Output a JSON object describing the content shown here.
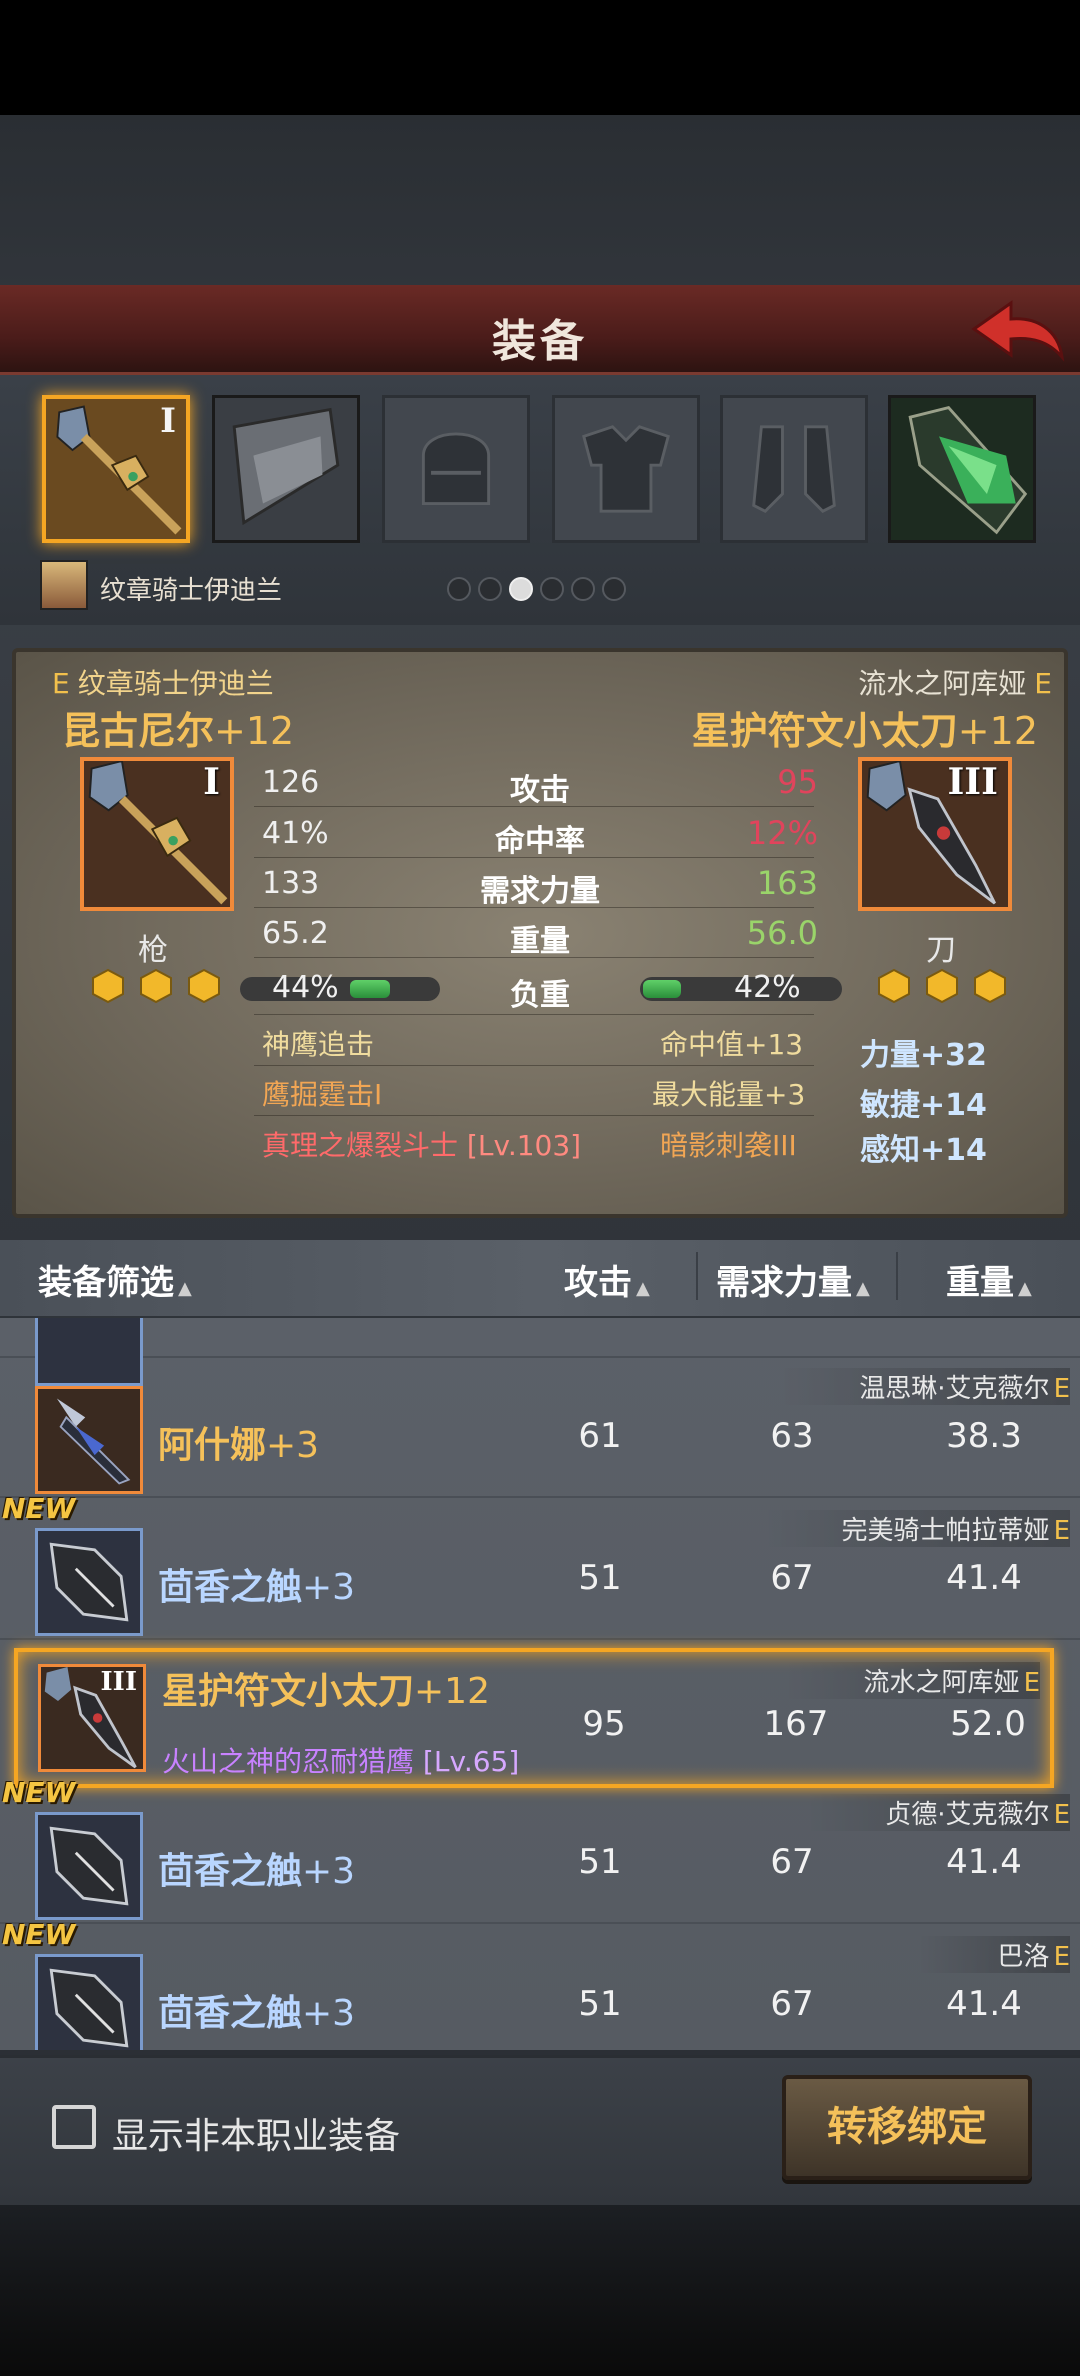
{
  "header": {
    "title": "装备"
  },
  "character": {
    "name": "纹章骑士伊迪兰"
  },
  "slots": [
    {
      "name": "spear-slot",
      "rank": "I",
      "selected": true
    },
    {
      "name": "banner-slot"
    },
    {
      "name": "helmet-slot"
    },
    {
      "name": "armor-slot"
    },
    {
      "name": "boots-slot"
    },
    {
      "name": "green-gem-slot"
    }
  ],
  "compare": {
    "left": {
      "owner": "纹章骑士伊迪兰",
      "owner_tag": "E",
      "weapon": "昆古尼尔",
      "plus": "+12",
      "rank": "I",
      "type": "枪",
      "attack": "126",
      "hit": "41%",
      "str": "133",
      "weight": "65.2",
      "load": "44%",
      "load_fraction": 0.44
    },
    "right": {
      "owner": "流水之阿库娅",
      "owner_tag": "E",
      "weapon": "星护符文小太刀",
      "plus": "+12",
      "rank": "III",
      "type": "刀",
      "attack": "95",
      "hit": "12%",
      "str": "163",
      "weight": "56.0",
      "load": "42%",
      "load_fraction": 0.42
    },
    "labels": {
      "attack": "攻击",
      "hit": "命中率",
      "str": "需求力量",
      "weight": "重量",
      "load": "负重"
    },
    "skills_left": [
      "神鹰追击",
      "鹰掘霆击I",
      "真理之爆裂斗士",
      "[Lv.103]"
    ],
    "skills_right": [
      "命中值+13",
      "最大能量+3",
      "暗影刺袭III"
    ],
    "bonuses": [
      "力量+32",
      "敏捷+14",
      "感知+14"
    ]
  },
  "list_header": {
    "filter": "装备筛选",
    "attack": "攻击",
    "str": "需求力量",
    "weight": "重量"
  },
  "list": [
    {
      "owner": "温思琳·艾克薇尔",
      "owner_tag": "E",
      "name": "阿什娜",
      "plus": "+3",
      "attack": "61",
      "str": "63",
      "weight": "38.3",
      "new": false,
      "icon_border": "orange"
    },
    {
      "owner": "完美骑士帕拉蒂娅",
      "owner_tag": "E",
      "name": "茴香之触",
      "plus": "+3",
      "attack": "51",
      "str": "67",
      "weight": "41.4",
      "new": true,
      "new_label": "NEW",
      "icon_border": "blue"
    },
    {
      "owner": "流水之阿库娅",
      "owner_tag": "E",
      "name": "星护符文小太刀",
      "plus": "+12",
      "rank": "III",
      "sub": "火山之神的忍耐猎鹰",
      "sub_lv": "[Lv.65]",
      "attack": "95",
      "str": "167",
      "weight": "52.0",
      "selected": true,
      "icon_border": "orange"
    },
    {
      "owner": "贞德·艾克薇尔",
      "owner_tag": "E",
      "name": "茴香之触",
      "plus": "+3",
      "attack": "51",
      "str": "67",
      "weight": "41.4",
      "new": true,
      "new_label": "NEW",
      "icon_border": "blue"
    },
    {
      "owner": "巴洛",
      "owner_tag": "E",
      "name": "茴香之触",
      "plus": "+3",
      "attack": "51",
      "str": "67",
      "weight": "41.4",
      "new": true,
      "new_label": "NEW",
      "icon_border": "blue"
    }
  ],
  "bottom": {
    "checkbox_label": "显示非本职业装备",
    "transfer_label": "转移绑定"
  }
}
